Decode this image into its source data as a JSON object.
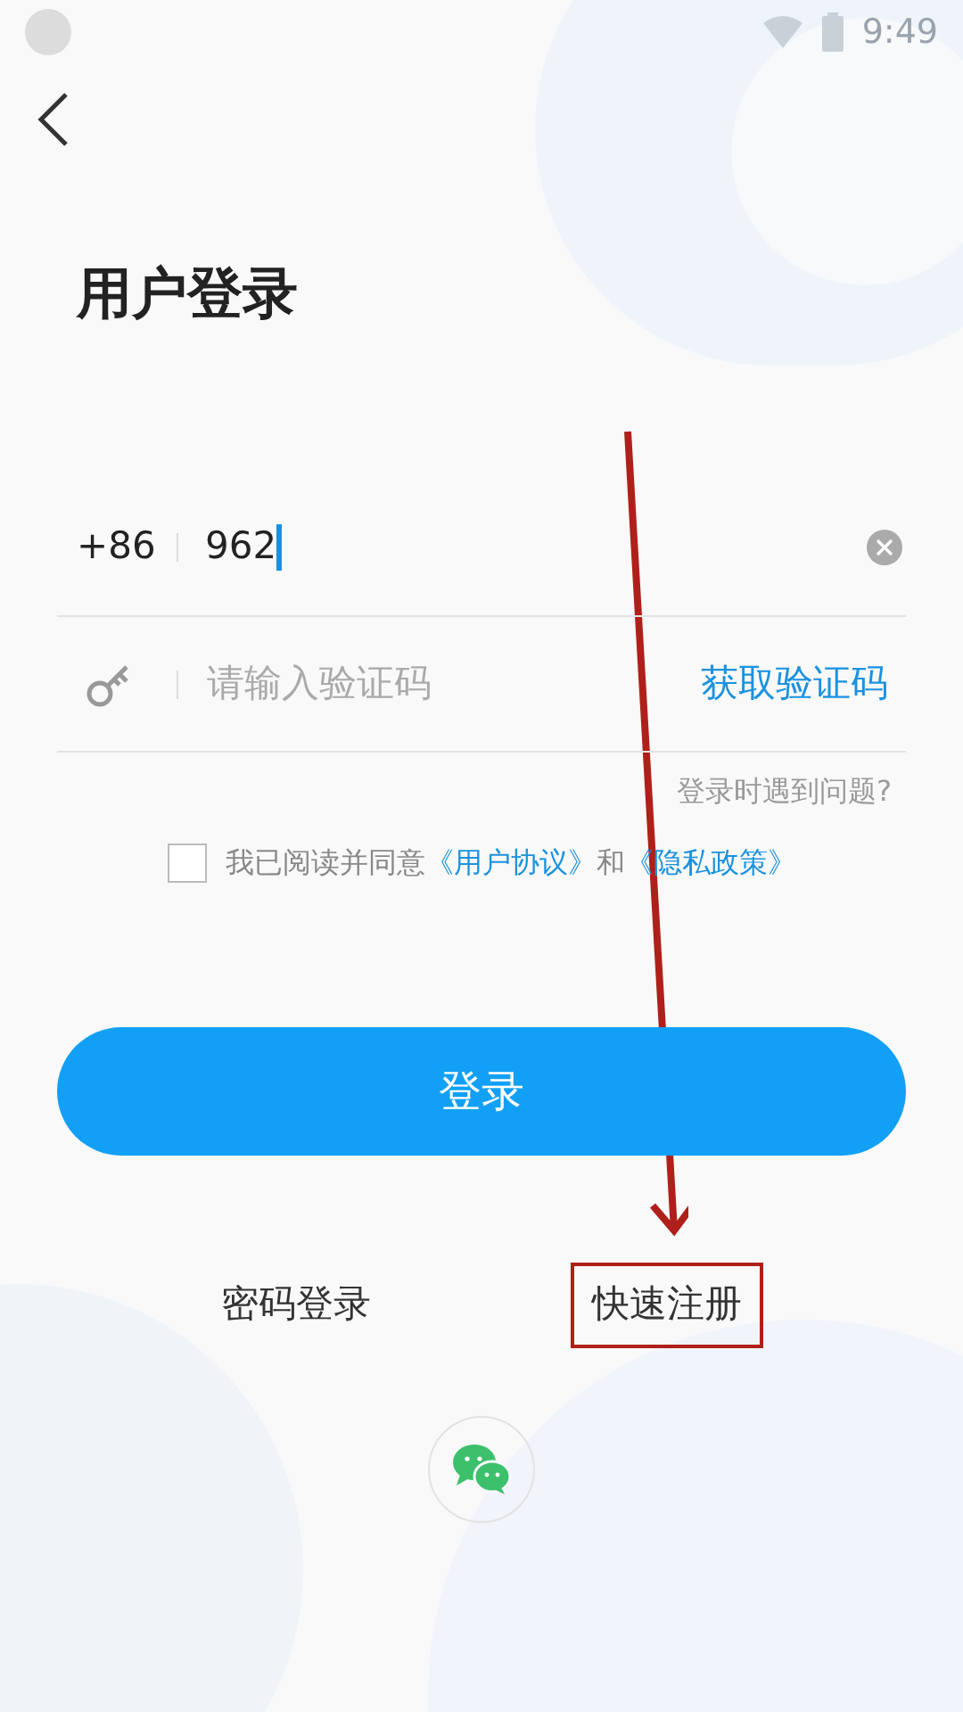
{
  "status_bar": {
    "time": "9:49"
  },
  "title": "用户登录",
  "phone": {
    "country_code": "+86",
    "value": "962"
  },
  "code": {
    "placeholder": "请输入验证码",
    "get_code": "获取验证码"
  },
  "trouble_link": "登录时遇到问题?",
  "agreement": {
    "checked": false,
    "text": "我已阅读并同意",
    "link1": "《用户协议》",
    "and": "和",
    "link2": "《隐私政策》"
  },
  "login_button": "登录",
  "options": [
    {
      "label": "密码登录",
      "highlighted": false
    },
    {
      "label": "快速注册",
      "highlighted": true
    }
  ]
}
